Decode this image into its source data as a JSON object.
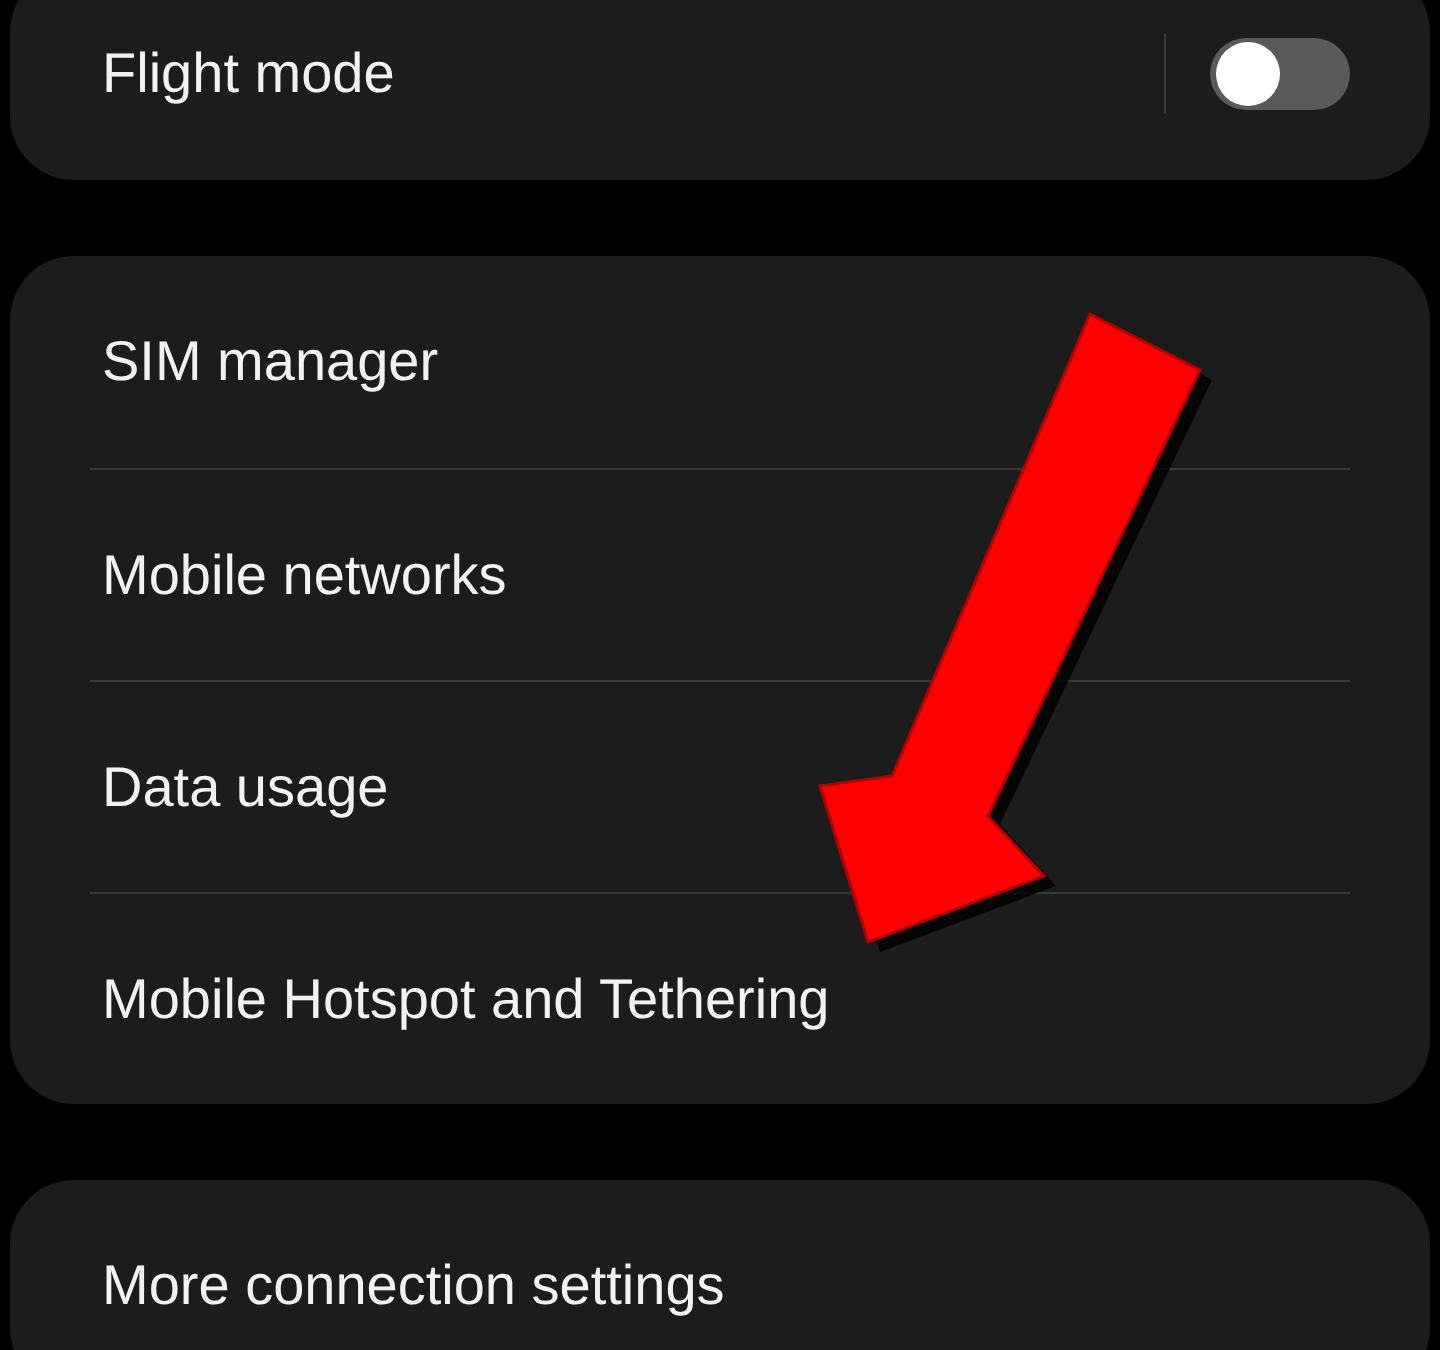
{
  "groups": [
    {
      "items": [
        {
          "label": "Flight mode",
          "kind": "toggle",
          "on": false
        }
      ]
    },
    {
      "items": [
        {
          "label": "SIM manager",
          "kind": "link"
        },
        {
          "label": "Mobile networks",
          "kind": "link"
        },
        {
          "label": "Data usage",
          "kind": "link"
        },
        {
          "label": "Mobile Hotspot and Tethering",
          "kind": "link"
        }
      ]
    },
    {
      "items": [
        {
          "label": "More connection settings",
          "kind": "link"
        }
      ]
    }
  ]
}
